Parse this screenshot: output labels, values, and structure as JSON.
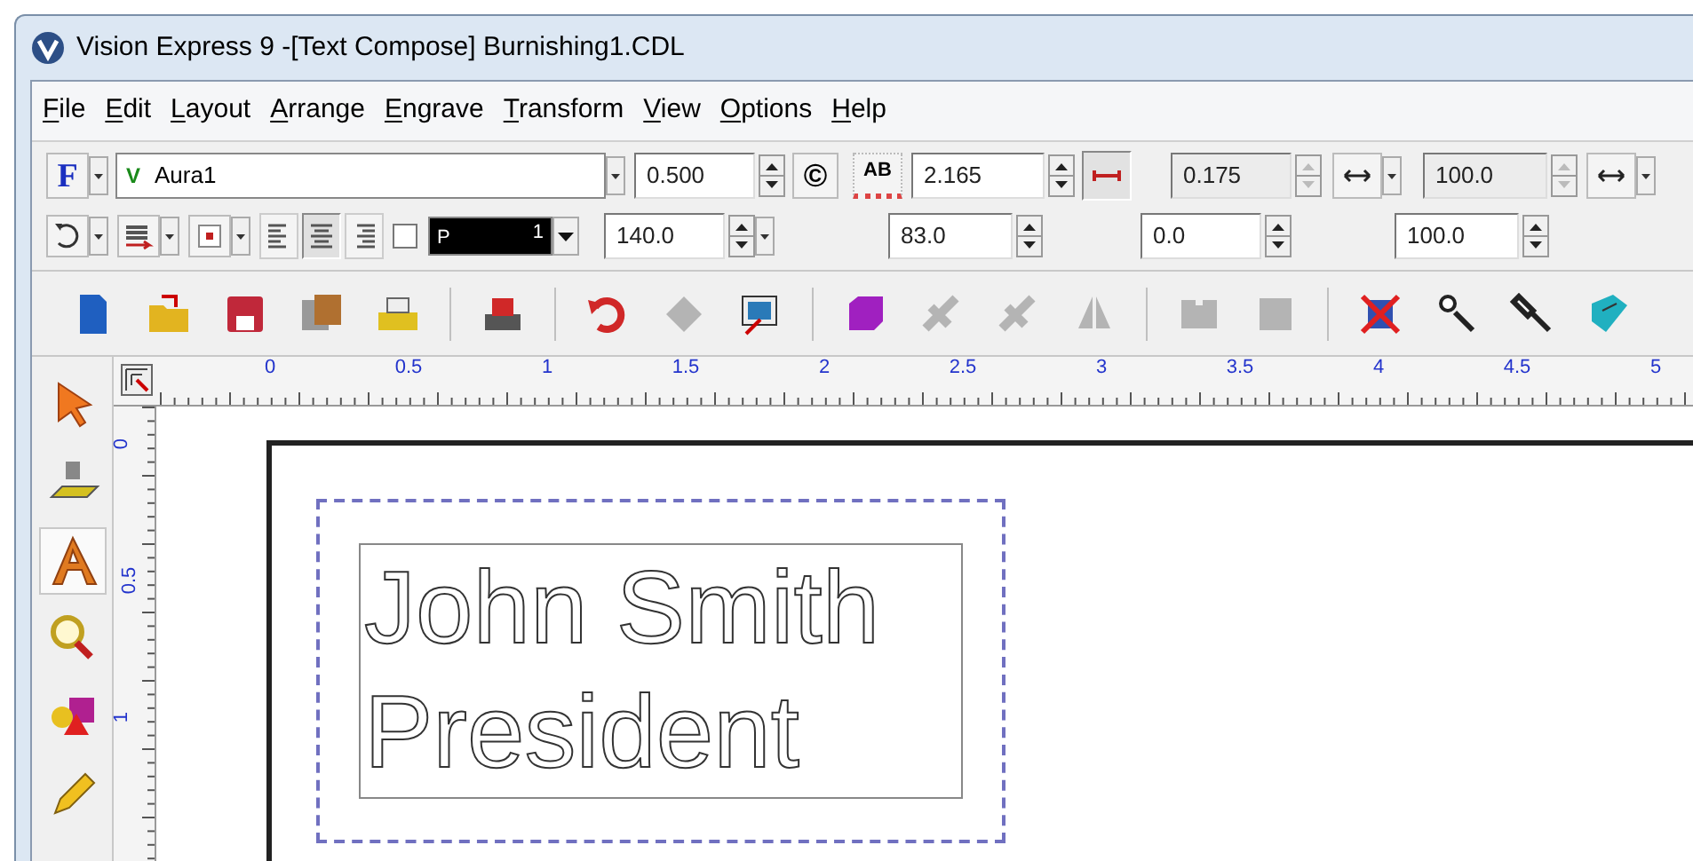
{
  "window": {
    "title": "Vision Express 9 -[Text Compose] Burnishing1.CDL"
  },
  "menu": [
    {
      "label": "File"
    },
    {
      "label": "Edit"
    },
    {
      "label": "Layout"
    },
    {
      "label": "Arrange"
    },
    {
      "label": "Engrave"
    },
    {
      "label": "Transform"
    },
    {
      "label": "View"
    },
    {
      "label": "Options"
    },
    {
      "label": "Help"
    }
  ],
  "text_toolbar": {
    "font_button": "F",
    "font_prefix": "V",
    "font": "Aura1",
    "height": {
      "value": "0.500",
      "disabled": false
    },
    "copyright_button": "©",
    "kerning_button": "AB",
    "width": {
      "value": "2.165",
      "disabled": false
    },
    "width_lock": {
      "on": true
    },
    "spacing": {
      "value": "0.175",
      "disabled": true
    },
    "scale_x": {
      "value": "100.0",
      "disabled": true
    },
    "align": [
      {
        "selected": false
      },
      {
        "selected": true
      },
      {
        "selected": false
      }
    ],
    "outline": {
      "checked": false
    },
    "pen": {
      "label": "P",
      "number": "1"
    },
    "angle": {
      "value": "140.0",
      "disabled": false
    },
    "slant": {
      "value": "83.0",
      "disabled": false
    },
    "offset": {
      "value": "0.0",
      "disabled": false
    },
    "scale_y": {
      "value": "100.0",
      "disabled": false
    }
  },
  "main_toolbar": [
    {
      "disabled": false
    },
    {
      "disabled": false
    },
    {
      "disabled": false
    },
    {
      "disabled": false
    },
    {
      "disabled": false
    },
    {
      "disabled": false
    },
    {
      "disabled": false
    },
    {
      "disabled": true
    },
    {
      "disabled": false
    },
    {
      "disabled": false
    },
    {
      "disabled": true
    },
    {
      "disabled": true
    },
    {
      "disabled": true
    },
    {
      "disabled": true
    },
    {
      "disabled": true
    },
    {
      "disabled": false
    },
    {
      "disabled": false
    },
    {
      "disabled": false
    },
    {
      "disabled": false
    }
  ],
  "tools": [
    {
      "selected": false
    },
    {
      "selected": false
    },
    {
      "selected": true
    },
    {
      "selected": false
    },
    {
      "selected": false
    },
    {
      "selected": false
    }
  ],
  "ruler": {
    "horizontal": [
      "0",
      "0.5",
      "1",
      "1.5",
      "2",
      "2.5",
      "3",
      "3.5",
      "4",
      "4.5",
      "5"
    ],
    "vertical": [
      "0",
      "0.5",
      "1"
    ]
  },
  "plate": {
    "lines": [
      "John Smith",
      "President"
    ]
  }
}
